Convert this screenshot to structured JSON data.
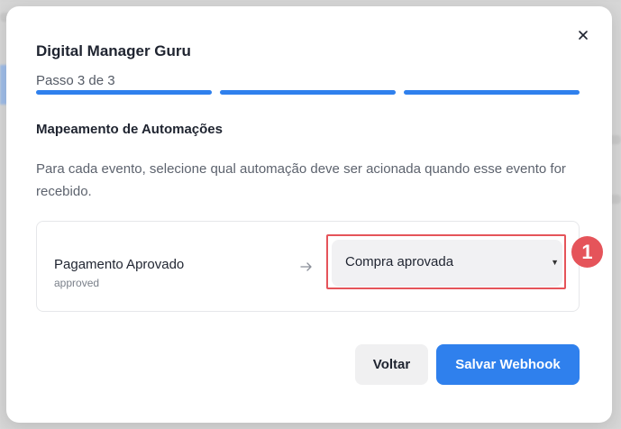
{
  "modal": {
    "title": "Digital Manager Guru",
    "step": "Passo 3 de 3",
    "progress_steps_total": 3,
    "progress_steps_completed": 3,
    "section_title": "Mapeamento de Automações",
    "description": "Para cada evento, selecione qual automação deve ser acionada quando esse evento for recebido.",
    "close_icon": "close-icon"
  },
  "mapping": {
    "event_name": "Pagamento Aprovado",
    "event_key": "approved",
    "arrow_icon": "arrow-right-icon",
    "selected_automation": "Compra aprovada"
  },
  "annotation": {
    "label": "1",
    "color": "#e5545a"
  },
  "buttons": {
    "back_label": "Voltar",
    "save_label": "Salvar Webhook"
  },
  "colors": {
    "primary": "#2f80ed",
    "highlight": "#e5545a"
  }
}
